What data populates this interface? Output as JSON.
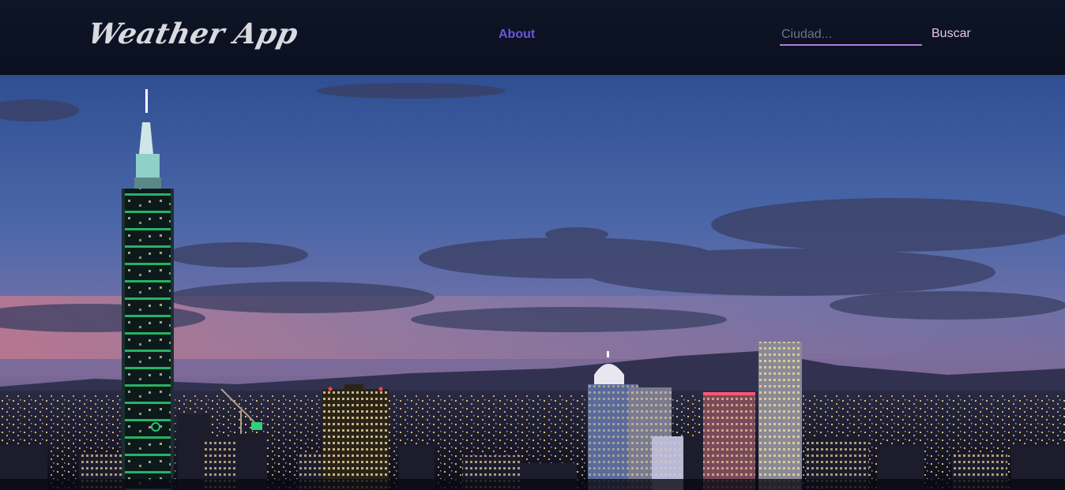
{
  "navbar": {
    "brand": "Weather App",
    "about_label": "About",
    "search": {
      "placeholder": "Ciudad...",
      "value": "",
      "button_label": "Buscar"
    }
  },
  "hero": {
    "image": "city-skyline-at-dusk"
  },
  "colors": {
    "navbar_bg": "#0b1121",
    "brand": "#d9d9e0",
    "about_link": "#6b55e0",
    "search_underline": "#b07be0",
    "search_button": "#e7c3e4"
  }
}
